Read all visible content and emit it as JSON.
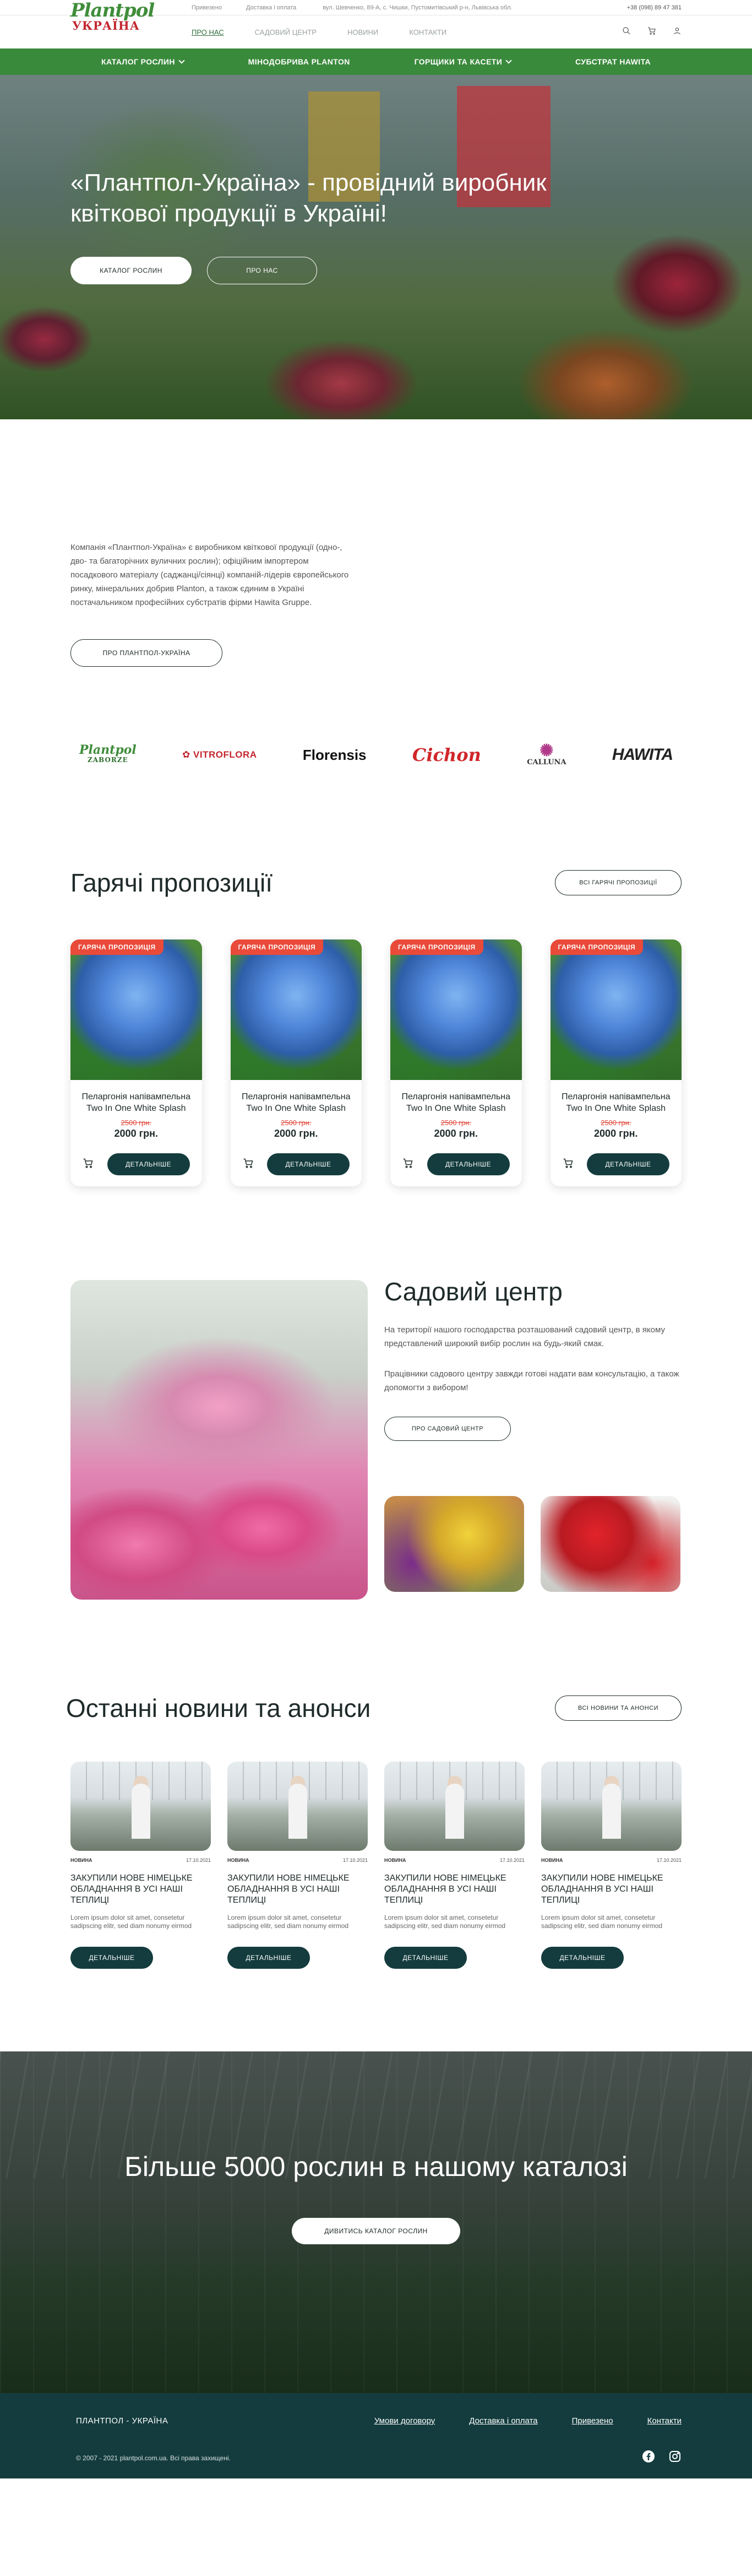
{
  "topbar": {
    "links": [
      "Привезено",
      "Доставка і оплата"
    ],
    "address": "вул. Шевченко, 89-А, с. Чишки, Пустомитівський р-н, Львівська обл.",
    "phone": "+38 (098) 89 47 381"
  },
  "logo": {
    "line1": "Plantpol",
    "line2": "УКРАЇНА"
  },
  "mainnav": [
    "Про нас",
    "Садовий центр",
    "Новини",
    "Контакти"
  ],
  "catnav": [
    "Каталог рослин",
    "Мінодобрива Planton",
    "Горщики та касети",
    "Субстрат Hawita"
  ],
  "hero": {
    "title": "«Плантпол-Україна» - провідний виробник квіткової продукції в Україні!",
    "btn_catalog": "Каталог рослин",
    "btn_about": "Про нас"
  },
  "about": {
    "text": "Компанія «Плантпол-Україна» є виробником квіткової продукції (одно-, дво- та багаторічних вуличних рослин); офіційним імпортером посадкового матеріалу (саджанці/сіянці) компаній-лідерів європейського ринку, мінеральних добрив Planton, а також єдиним в Україні постачальником професійних субстратів фірми Hawita Gruppe.",
    "button": "Про Плантпол-Україна"
  },
  "partners": [
    {
      "name": "Plantpol",
      "sub": "ZABORZE"
    },
    {
      "name": "✿ VITROFLORA"
    },
    {
      "name": "Florensis"
    },
    {
      "name": "Cichon"
    },
    {
      "name": "CALLUNA"
    },
    {
      "name": "HAWITA"
    }
  ],
  "hot": {
    "title": "Гарячі пропозиції",
    "all_button": "Всі гарячі пропозиції",
    "badge": "Гаряча пропозиція",
    "detail_button": "Детальніше",
    "products": [
      {
        "name": "Пеларгонія напівампельна Two In One White Splash",
        "old_price": "2500 грн.",
        "price": "2000 грн."
      },
      {
        "name": "Пеларгонія напівампельна Two In One White Splash",
        "old_price": "2500 грн.",
        "price": "2000 грн."
      },
      {
        "name": "Пеларгонія напівампельна Two In One White Splash",
        "old_price": "2500 грн.",
        "price": "2000 грн."
      },
      {
        "name": "Пеларгонія напівампельна Two In One White Splash",
        "old_price": "2500 грн.",
        "price": "2000 грн."
      }
    ]
  },
  "garden": {
    "title": "Садовий центр",
    "p1": "На території нашого господарства розташований садовий центр, в якому представлений широкий вибір рослин на будь-який смак.",
    "p2": "Працівники садового центру завжди готові надати вам консультацію, а також допомогти з вибором!",
    "button": "Про садовий центр"
  },
  "news": {
    "title": "Останні новини та анонси",
    "all_button": "Всі новини та анонси",
    "detail_button": "Детальніше",
    "items": [
      {
        "tag": "Новина",
        "date": "17.10.2021",
        "title": "Закупили нове німецьке обладнання в усі наші теплиці",
        "text": "Lorem ipsum dolor sit amet, consetetur sadipscing elitr, sed diam nonumy eirmod"
      },
      {
        "tag": "Новина",
        "date": "17.10.2021",
        "title": "Закупили нове німецьке обладнання в усі наші теплиці",
        "text": "Lorem ipsum dolor sit amet, consetetur sadipscing elitr, sed diam nonumy eirmod"
      },
      {
        "tag": "Новина",
        "date": "17.10.2021",
        "title": "Закупили нове німецьке обладнання в усі наші теплиці",
        "text": "Lorem ipsum dolor sit amet, consetetur sadipscing elitr, sed diam nonumy eirmod"
      },
      {
        "tag": "Новина",
        "date": "17.10.2021",
        "title": "Закупили нове німецьке обладнання в усі наші теплиці",
        "text": "Lorem ipsum dolor sit amet, consetetur sadipscing elitr, sed diam nonumy eirmod"
      }
    ]
  },
  "cta": {
    "title": "Більше 5000 рослин в нашому каталозі",
    "button": "Дивитись каталог рослин"
  },
  "footer": {
    "brand": "Плантпол - Україна",
    "links": [
      "Умови договору",
      "Доставка і оплата",
      "Привезено",
      "Контакти"
    ],
    "copyright": "© 2007 - 2021 plantpol.com.ua. Всі права захищені."
  },
  "colors": {
    "green": "#3a8a3c",
    "dark_teal": "#143c3e",
    "hot_red": "#ea4a3a"
  }
}
